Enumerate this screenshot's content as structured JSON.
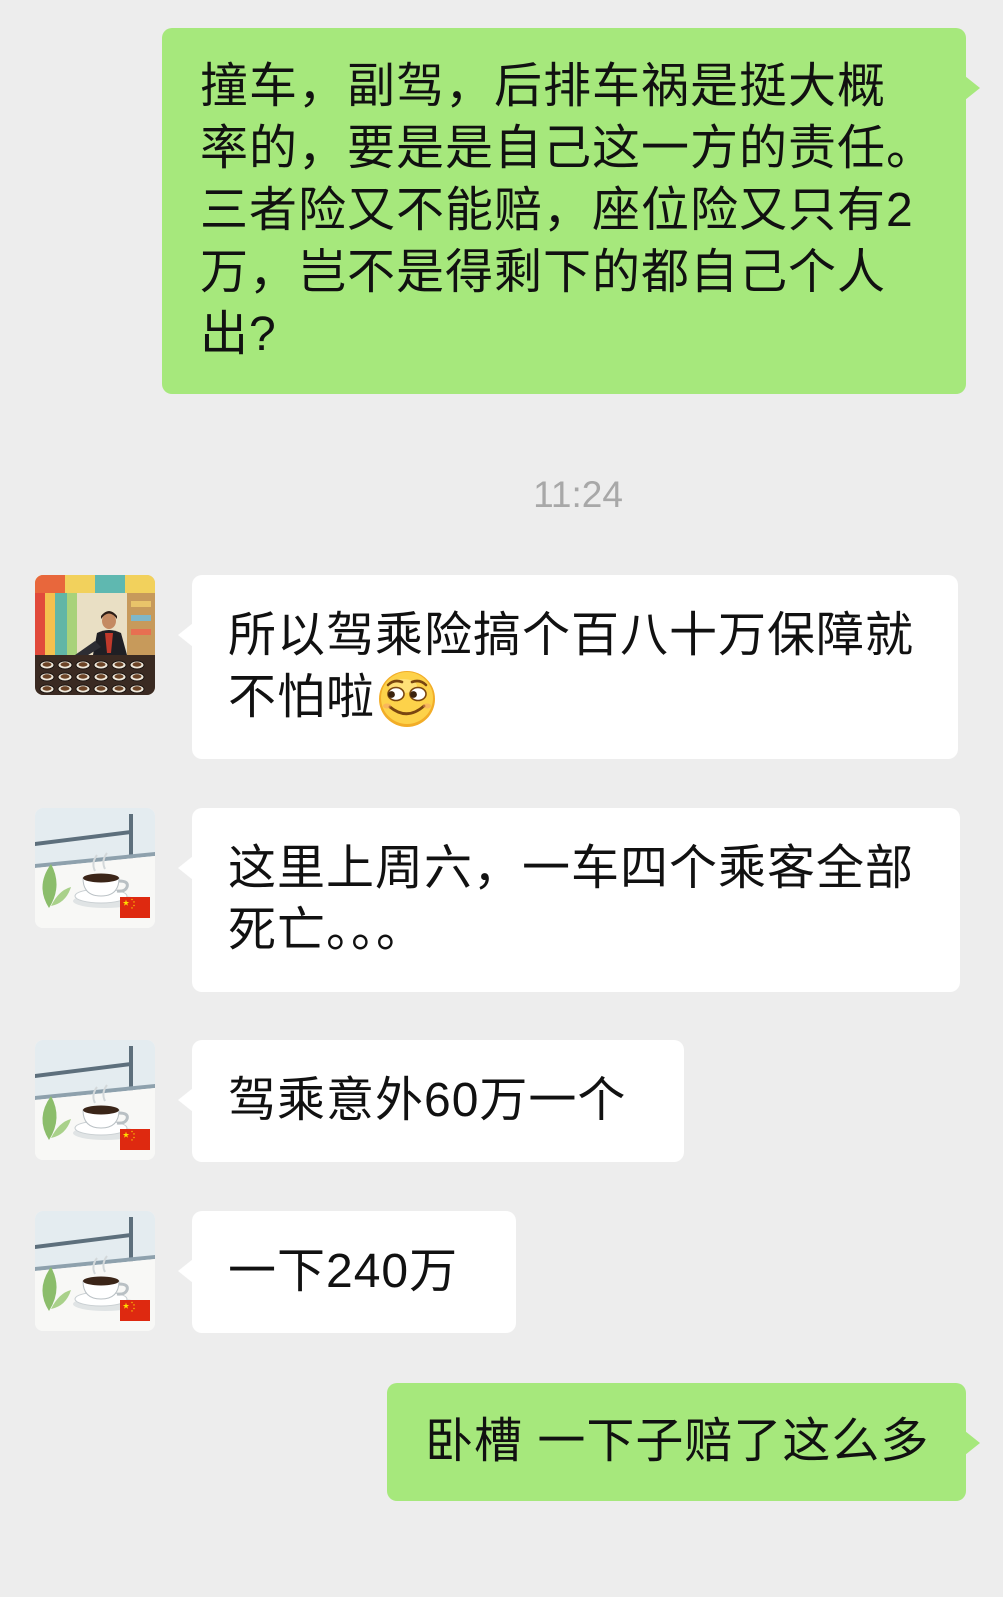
{
  "chat": {
    "colors": {
      "background": "#ededed",
      "outgoing_bubble": "#a6e87c",
      "incoming_bubble": "#ffffff",
      "message_text": "#111111",
      "timestamp_text": "#a8a8a8"
    },
    "timestamp": "11:24",
    "messages": [
      {
        "from_self": true,
        "lines": [
          "撞车，副驾，后排车祸是挺大概",
          "率的，要是是自己这一方的责任。",
          "三者险又不能赔，座位险又只有2",
          "万，岂不是得剩下的都自己个人",
          "出?"
        ]
      },
      {
        "from_self": false,
        "avatar_icon": "photo-avatar-icon",
        "lines": [
          "所以驾乘险搞个百八十万保障就",
          "不怕啦"
        ],
        "trailing_emoji": "sly-smile-emoji-icon"
      },
      {
        "from_self": false,
        "avatar_icon": "coffee-cup-avatar-icon",
        "avatar_badge": "china-flag-icon",
        "lines": [
          "这里上周六，一车四个乘客全部",
          "死亡。。。"
        ]
      },
      {
        "from_self": false,
        "avatar_icon": "coffee-cup-avatar-icon",
        "avatar_badge": "china-flag-icon",
        "lines": [
          "驾乘意外60万一个"
        ]
      },
      {
        "from_self": false,
        "avatar_icon": "coffee-cup-avatar-icon",
        "avatar_badge": "china-flag-icon",
        "lines": [
          "一下240万"
        ]
      },
      {
        "from_self": true,
        "lines": [
          "卧槽 一下子赔了这么多"
        ]
      }
    ]
  }
}
